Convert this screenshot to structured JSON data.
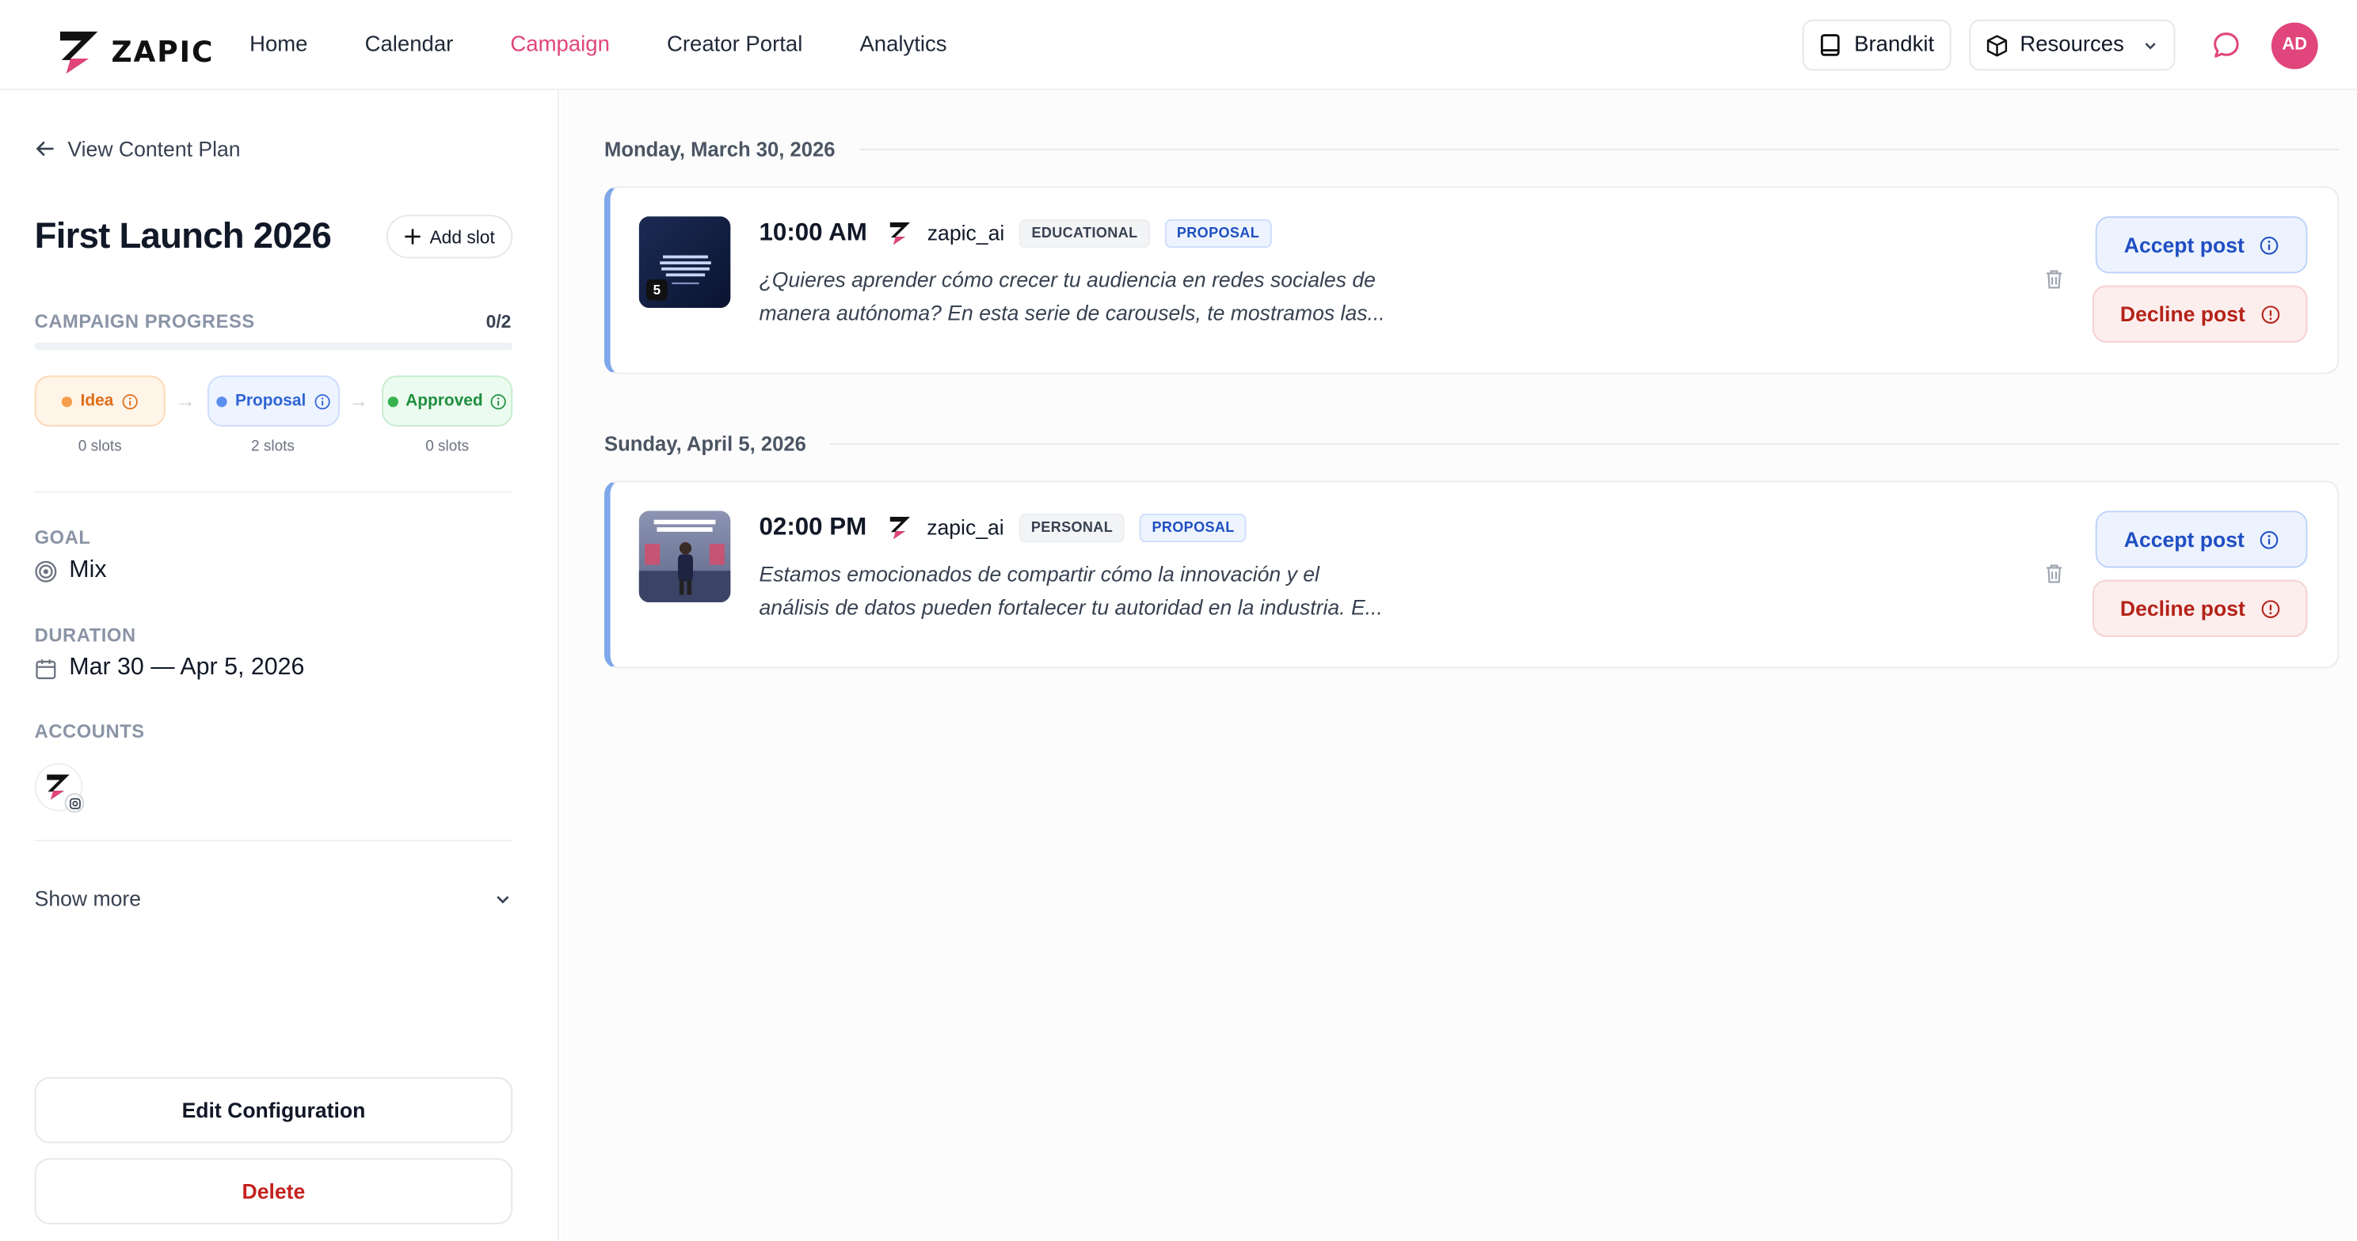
{
  "brand": {
    "name": "ZAPIC",
    "accent": "#e0457b"
  },
  "nav": {
    "links": [
      "Home",
      "Calendar",
      "Campaign",
      "Creator Portal",
      "Analytics"
    ],
    "active": "Campaign",
    "brandkit_label": "Brandkit",
    "resources_label": "Resources",
    "avatar_initials": "AD"
  },
  "sidebar": {
    "back_label": "View Content Plan",
    "title": "First Launch 2026",
    "add_slot_label": "Add slot",
    "progress": {
      "label": "CAMPAIGN PROGRESS",
      "count": "0/2",
      "fraction": 0
    },
    "stages": [
      {
        "label": "Idea",
        "slots": "0 slots",
        "color": "#e06d16"
      },
      {
        "label": "Proposal",
        "slots": "2 slots",
        "color": "#2f63d6"
      },
      {
        "label": "Approved",
        "slots": "0 slots",
        "color": "#1f8f3f"
      }
    ],
    "goal": {
      "label": "GOAL",
      "value": "Mix"
    },
    "duration": {
      "label": "DURATION",
      "value": "Mar 30 — Apr 5, 2026"
    },
    "accounts": {
      "label": "ACCOUNTS"
    },
    "show_more_label": "Show more",
    "edit_label": "Edit Configuration",
    "delete_label": "Delete"
  },
  "schedule": [
    {
      "date": "Monday, March 30, 2026",
      "post": {
        "time": "10:00 AM",
        "account": "zapic_ai",
        "type_tag": "EDUCATIONAL",
        "status_tag": "PROPOSAL",
        "thumb_count": "5",
        "text_line1": "¿Quieres aprender cómo crecer tu audiencia en redes sociales de",
        "text_line2": "manera autónoma? En esta serie de carousels, te mostramos las...",
        "accept_label": "Accept post",
        "decline_label": "Decline post"
      }
    },
    {
      "date": "Sunday, April 5, 2026",
      "post": {
        "time": "02:00 PM",
        "account": "zapic_ai",
        "type_tag": "PERSONAL",
        "status_tag": "PROPOSAL",
        "text_line1": "Estamos emocionados de compartir cómo la innovación y el",
        "text_line2": "análisis de datos pueden fortalecer tu autoridad en la industria. E...",
        "accept_label": "Accept post",
        "decline_label": "Decline post"
      }
    }
  ]
}
